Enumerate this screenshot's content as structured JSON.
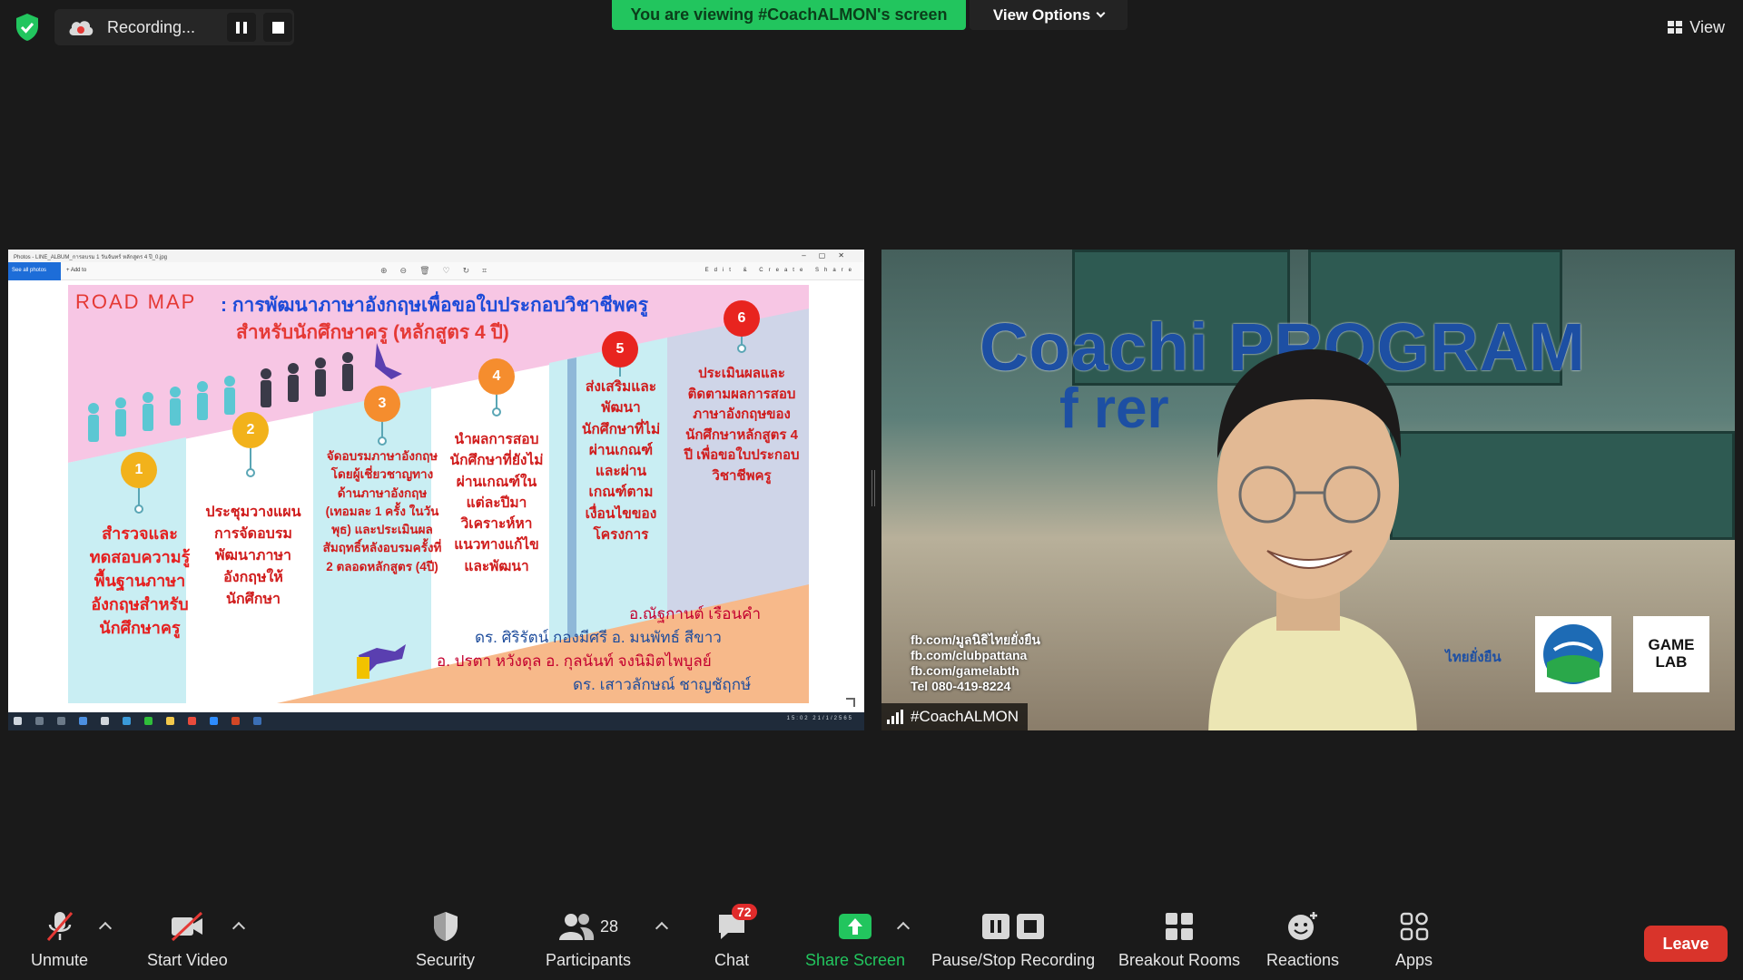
{
  "top_bar": {
    "recording_label": "Recording...",
    "viewing_banner": "You are viewing #CoachALMON's screen",
    "view_options_label": "View Options",
    "view_label": "View"
  },
  "shared_screen": {
    "window_title": "Photos - LINE_ALBUM_การอบรม 1 วันจันทร์ หลักสูตร 4 ปี_0.jpg",
    "see_all_label": "See all photos",
    "add_to_label": "+ Add to",
    "edit_label": "Edit & Create",
    "share_label": "Share",
    "slide": {
      "title_left": "ROAD  MAP",
      "title_right": ": การพัฒนาภาษาอังกฤษเพื่อขอใบประกอบวิชาชีพครู",
      "title_line2": "สำหรับนักศึกษาครู (หลักสูตร 4 ปี)",
      "steps": [
        {
          "num": "1",
          "color": "#f2b21b",
          "text": "สำรวจและทดสอบความรู้พื้นฐานภาษาอังกฤษสำหรับนักศึกษาครู"
        },
        {
          "num": "2",
          "color": "#f2b21b",
          "text": "ประชุมวางแผนการจัดอบรมพัฒนาภาษาอังกฤษให้นักศึกษา"
        },
        {
          "num": "3",
          "color": "#f58d2e",
          "text": "จัดอบรมภาษาอังกฤษ โดยผู้เชี่ยวชาญทางด้านภาษาอังกฤษ (เทอมละ 1 ครั้ง ในวันพุธ) และประเมินผลสัมฤทธิ์หลังอบรมครั้งที่ 2 ตลอดหลักสูตร (4ปี)"
        },
        {
          "num": "4",
          "color": "#f58d2e",
          "text": "นำผลการสอบนักศึกษาที่ยังไม่ผ่านเกณฑ์ในแต่ละปีมาวิเคราะห์หาแนวทางแก้ไขและพัฒนา"
        },
        {
          "num": "5",
          "color": "#e8241f",
          "text": "ส่งเสริมและพัฒนานักศึกษาที่ไม่ผ่านเกณฑ์และผ่านเกณฑ์ตามเงื่อนไขของโครงการ"
        },
        {
          "num": "6",
          "color": "#e8241f",
          "text": "ประเมินผลและติดตามผลการสอบภาษาอังกฤษของนักศึกษาหลักสูตร 4 ปี เพื่อขอใบประกอบวิชาชีพครู"
        }
      ],
      "names_line1": "อ.ณัฐกานต์  เรือนคำ",
      "names_line2": "ดร. ศิริรัตน์  กองมีศรี อ. มนพัทธ์  สีขาว",
      "names_line3": "อ. ปรตา  หวังดุล  อ. กุลนันท์  จงนิมิตไพบูลย์",
      "names_line4": "ดร. เสาวลักษณ์  ชาญชัฤกษ์"
    },
    "tray_text": "15:02 21/1/2565"
  },
  "video_tile": {
    "banner_line1": "Coachi    PROGRAM",
    "banner_line2": "f         rer",
    "fb_links": [
      "fb.com/มูลนิธิไทยยั่งยืน",
      "fb.com/clubpattana",
      "fb.com/gamelabth",
      "Tel 080-419-8224"
    ],
    "logo_thai": "ไทยยั่งยืน",
    "logo_gamelab": "GAME LAB",
    "participant_name": "#CoachALMON"
  },
  "toolbar": {
    "unmute": "Unmute",
    "start_video": "Start Video",
    "security": "Security",
    "participants": "Participants",
    "participants_count": "28",
    "chat": "Chat",
    "chat_badge": "72",
    "share_screen": "Share Screen",
    "pause_stop_recording": "Pause/Stop Recording",
    "breakout_rooms": "Breakout Rooms",
    "reactions": "Reactions",
    "apps": "Apps",
    "leave": "Leave"
  },
  "colors": {
    "banner_green": "#22c55e",
    "leave_red": "#d9342b",
    "chat_badge_red": "#e02b2b"
  }
}
